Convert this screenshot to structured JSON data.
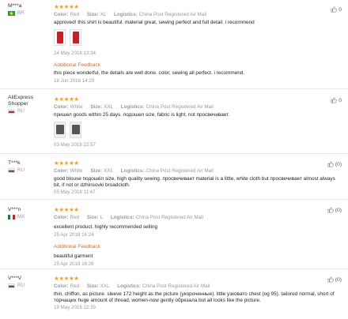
{
  "reviews": [
    {
      "user": "M***a",
      "country": "BR",
      "flag": "br",
      "stars": "★★★★★",
      "color_label": "Color:",
      "color": "Red",
      "size_label": "Size:",
      "size": "XL",
      "logistics_label": "Logistics:",
      "logistics": "China Post Registered Air Mail",
      "text": "approved! this shirt is beautiful. material great, sewing perfect and full detail. i recommend",
      "date": "24 May 2018 13:34",
      "additional_title": "Additional Feedback",
      "additional_text": "this piece wonderful, the details are well done. color, sewing all perfect. i recommend.",
      "additional_date": "18 Jun 2018 14:29",
      "helpful": "0"
    },
    {
      "user": "AliExpress Shopper",
      "country": "RU",
      "flag": "ru",
      "stars": "★★★★★",
      "color_label": "Color:",
      "color": "White",
      "size_label": "Size:",
      "size": "XXL",
      "logistics_label": "Logistics:",
      "logistics": "China Post Registered Air Mail",
      "text": "пришел goods within 25 days. подошел size. fabric is light, not просвечивает.",
      "date": "03 May 2018 22:57",
      "helpful": "0"
    },
    {
      "user": "T***k",
      "country": "RU",
      "flag": "ru",
      "stars": "★★★★★",
      "color_label": "Color:",
      "color": "White",
      "size_label": "Size:",
      "size": "XXL",
      "logistics_label": "Logistics:",
      "logistics": "China Post Registered Air Mail",
      "text": "good blouse подошёл size, high quality sewing. просвечивает material is a little, white cloth but просвечивает almost always bit, if not or dzhinsovki broadcloth.",
      "date": "05 May 2018 11:47",
      "helpful": "(0)"
    },
    {
      "user": "V***n",
      "country": "MX",
      "flag": "mx",
      "stars": "★★★★★",
      "color_label": "Color:",
      "color": "Red",
      "size_label": "Size:",
      "size": "L",
      "logistics_label": "Logistics:",
      "logistics": "China Post Registered Air Mail",
      "text": "excellent product. highly recommended selling",
      "date": "25 Apr 2018 16:24",
      "additional_title": "Additional Feedback",
      "additional_text": "beautiful garment",
      "additional_date": "25 Apr 2018 16:26",
      "helpful": "(0)"
    },
    {
      "user": "V***V",
      "country": "RU",
      "flag": "ru",
      "stars": "★★★★★",
      "color_label": "Color:",
      "color": "Red",
      "size_label": "Size:",
      "size": "XXL",
      "logistics_label": "Logistics:",
      "logistics": "China Post Registered Air Mail",
      "text": "thin, chiffon, as picture. sleeve 172 height as the picture (укороченные). little узковато chest (og 95). tailored normal, short of торчащих huge amount of thread, women-now gently обрезала but all looks like the picture.",
      "date": "19 May 2018 12:39",
      "helpful": "(0)"
    }
  ],
  "colors": {
    "star": "#f6a01b",
    "additional": "#e26b1b"
  },
  "icons": {
    "helpful": "thumbs-up-icon"
  }
}
